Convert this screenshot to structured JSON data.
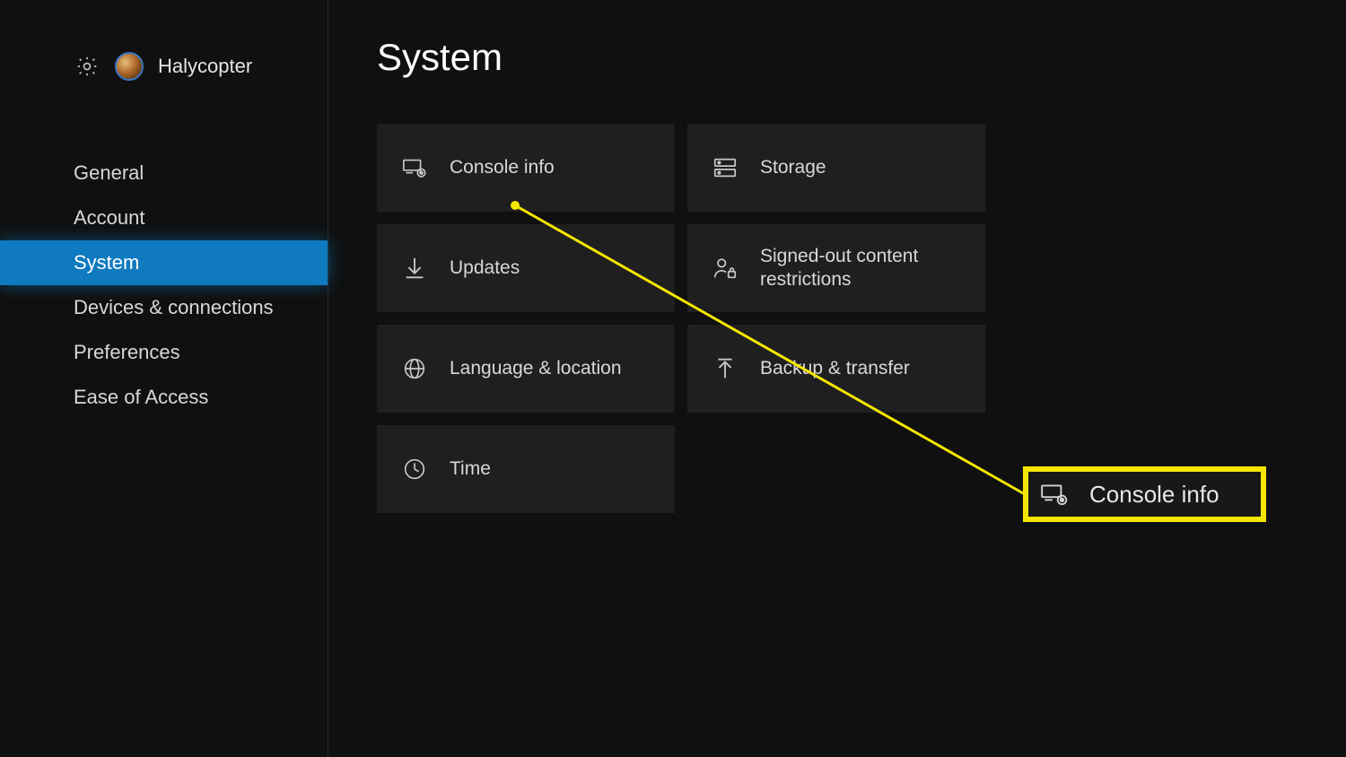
{
  "header": {
    "username": "Halycopter"
  },
  "sidebar": {
    "items": [
      {
        "label": "General"
      },
      {
        "label": "Account"
      },
      {
        "label": "System"
      },
      {
        "label": "Devices & connections"
      },
      {
        "label": "Preferences"
      },
      {
        "label": "Ease of Access"
      }
    ],
    "active_index": 2
  },
  "main": {
    "title": "System",
    "tiles": [
      {
        "label": "Console info",
        "icon": "console-gear-icon"
      },
      {
        "label": "Storage",
        "icon": "storage-icon"
      },
      {
        "label": "Updates",
        "icon": "download-arrow-icon"
      },
      {
        "label": "Signed-out content restrictions",
        "icon": "person-lock-icon"
      },
      {
        "label": "Language & location",
        "icon": "globe-icon"
      },
      {
        "label": "Backup & transfer",
        "icon": "arrow-up-icon"
      },
      {
        "label": "Time",
        "icon": "clock-icon"
      }
    ]
  },
  "callout": {
    "label": "Console info"
  },
  "colors": {
    "accent": "#0f7ac0",
    "highlight": "#f5e600"
  }
}
